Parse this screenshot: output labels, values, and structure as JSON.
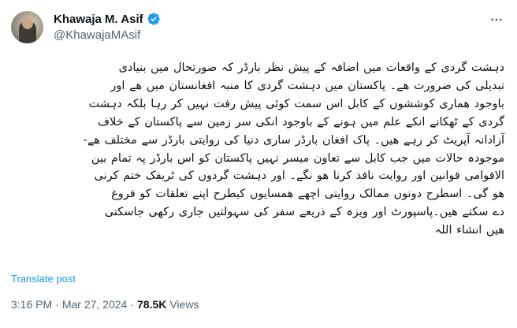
{
  "author": {
    "display_name": "Khawaja M. Asif",
    "handle": "@KhawajaMAsif",
    "verified": true,
    "verified_color": "#1d9bf0"
  },
  "icons": {
    "verified": "verified-badge-icon",
    "more": "more-options-icon"
  },
  "tweet": {
    "lines": [
      "دہشت گردی کے واقعات میں اضافہ کے پیش نظر بارڈر کہ صورتحال میں بنیادی",
      "تبدیلی کی ضرورت ھے۔ پاکستان میں دہشت گردی کا منبہ افغانستان میں ھے اور",
      "باوجود ھماری کوششوں کے کابل اس سمت کوئی پیش رفت نہیں کر رہا بلکہ دہشت",
      "گردی کے ٹھکانے انکے علم میں ہونے کے باوجود انکی سر زمین سے پاکستان کے خلاف",
      "آزادانہ آپریٹ کر رہے ھیں۔ پاک افغان بارڈر ساری دنیا کی روایتی بارڈر سے مختلف ھے-",
      "موجودہ حالات میں جب کابل سے تعاون میسر نہیں  پاکستان کو اس بارڈر پہ تمام بین",
      "الاقوامی قوانین اور روایت نافذ کرنا ھو نگے۔ اور دہشت گردوں کی ٹریفک ختم کرنی",
      "ھو گی۔ اسطرح دونوں ممالک روایتی اچھے ھمسایوں کیطرح اپنے تعلقات کو فروغ",
      "دے سکتے ھیں۔پاسپورٹ اور ویزہ کے ذریعے سفر کی سہولتیں جاری رکھی جاسکتی",
      "ھیں انشاء اللہ"
    ]
  },
  "translate_label": "Translate post",
  "meta": {
    "time": "3:16 PM",
    "separator": "·",
    "date": "Mar 27, 2024",
    "views_count": "78.5K",
    "views_label": "Views"
  }
}
